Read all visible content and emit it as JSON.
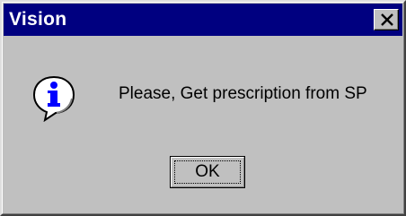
{
  "window": {
    "title": "Vision",
    "close_icon": "close-icon"
  },
  "dialog": {
    "icon": "information-icon",
    "message": "Please, Get prescription from SP",
    "ok_label": "OK"
  },
  "colors": {
    "titlebar": "#000080",
    "face": "#c0c0c0",
    "info_blue": "#0000ff"
  }
}
